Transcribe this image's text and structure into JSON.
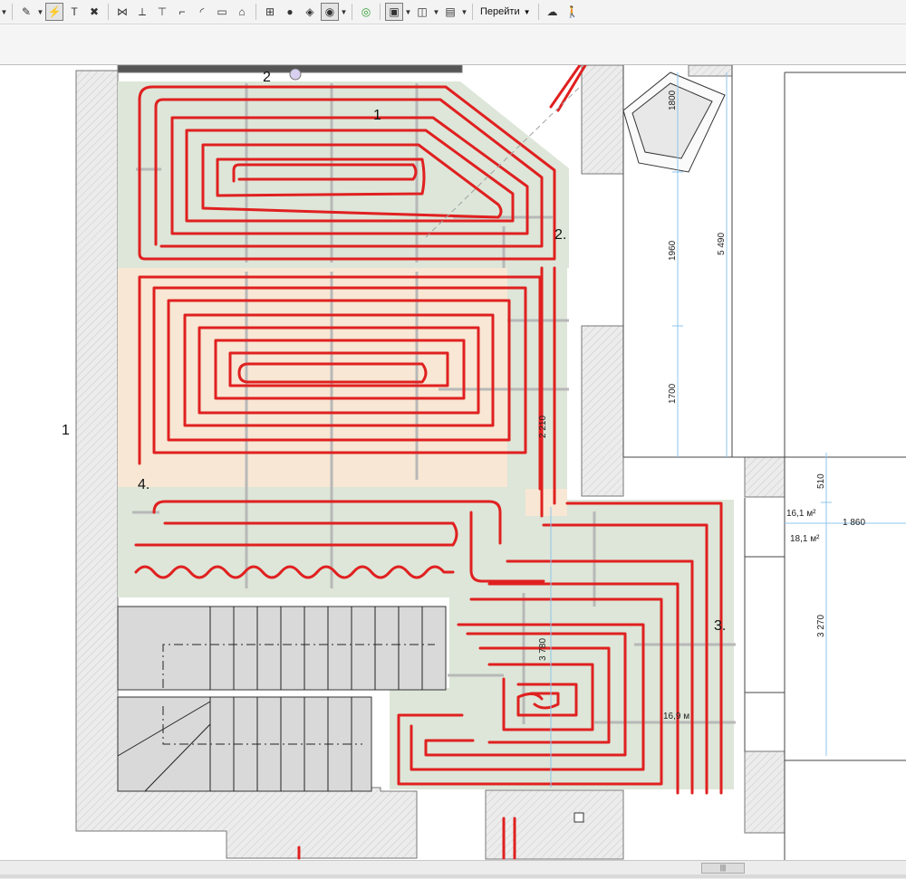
{
  "toolbar": {
    "goto_label": "Перейти",
    "icons": [
      "selection-arrow-icon",
      "pencil-tool-icon",
      "magic-wand-icon",
      "text-tool-icon",
      "delete-icon",
      "split-icon",
      "trim-icon",
      "adjust-icon",
      "offset-icon",
      "fillet-icon",
      "group-icon",
      "house-icon",
      "detail-icon",
      "marker-icon",
      "layer-icon",
      "view-icon",
      "target-icon",
      "plan-icon",
      "section-icon",
      "layout-icon",
      "navigator-icon",
      "walk-icon"
    ]
  },
  "drawing": {
    "colors": {
      "pipe": "#e02020",
      "zone_green": "#dde6d8",
      "zone_beige": "#f7e7d4",
      "wall": "#e2e2e2",
      "dim_line": "#8fc4ec",
      "stair": "#d9d9d9"
    },
    "zone_labels": [
      "1",
      "2.",
      "3.",
      "4."
    ],
    "room_numbers": [
      "1",
      "2"
    ],
    "dimensions": [
      "1800",
      "1960",
      "5 490",
      "1700",
      "510",
      "1 860",
      "3 270",
      "2 210",
      "3 780"
    ],
    "areas": [
      "16,1 м²",
      "18,1 м²"
    ],
    "length_label": "16,9 м"
  }
}
